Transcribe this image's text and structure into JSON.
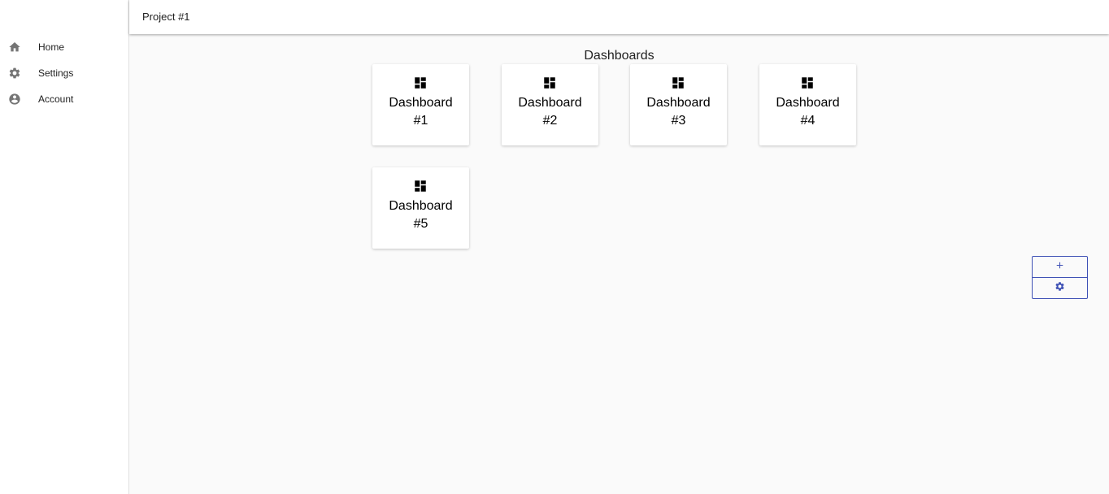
{
  "sidebar": {
    "items": [
      {
        "label": "Home",
        "icon": "home-icon"
      },
      {
        "label": "Settings",
        "icon": "gear-icon"
      },
      {
        "label": "Account",
        "icon": "account-circle-icon"
      }
    ]
  },
  "header": {
    "title": "Project #1"
  },
  "main": {
    "section_title": "Dashboards",
    "dashboards": [
      {
        "line1": "Dashboard",
        "line2": "#1",
        "icon": "dashboard-icon"
      },
      {
        "line1": "Dashboard",
        "line2": "#2",
        "icon": "dashboard-icon"
      },
      {
        "line1": "Dashboard",
        "line2": "#3",
        "icon": "dashboard-icon"
      },
      {
        "line1": "Dashboard",
        "line2": "#4",
        "icon": "dashboard-icon"
      },
      {
        "line1": "Dashboard",
        "line2": "#5",
        "icon": "dashboard-icon"
      }
    ]
  },
  "actions": {
    "add_icon": "plus-icon",
    "settings_icon": "gear-icon"
  },
  "colors": {
    "accent": "#3f51b5",
    "icon_gray": "#757575",
    "background": "#fafafa"
  }
}
